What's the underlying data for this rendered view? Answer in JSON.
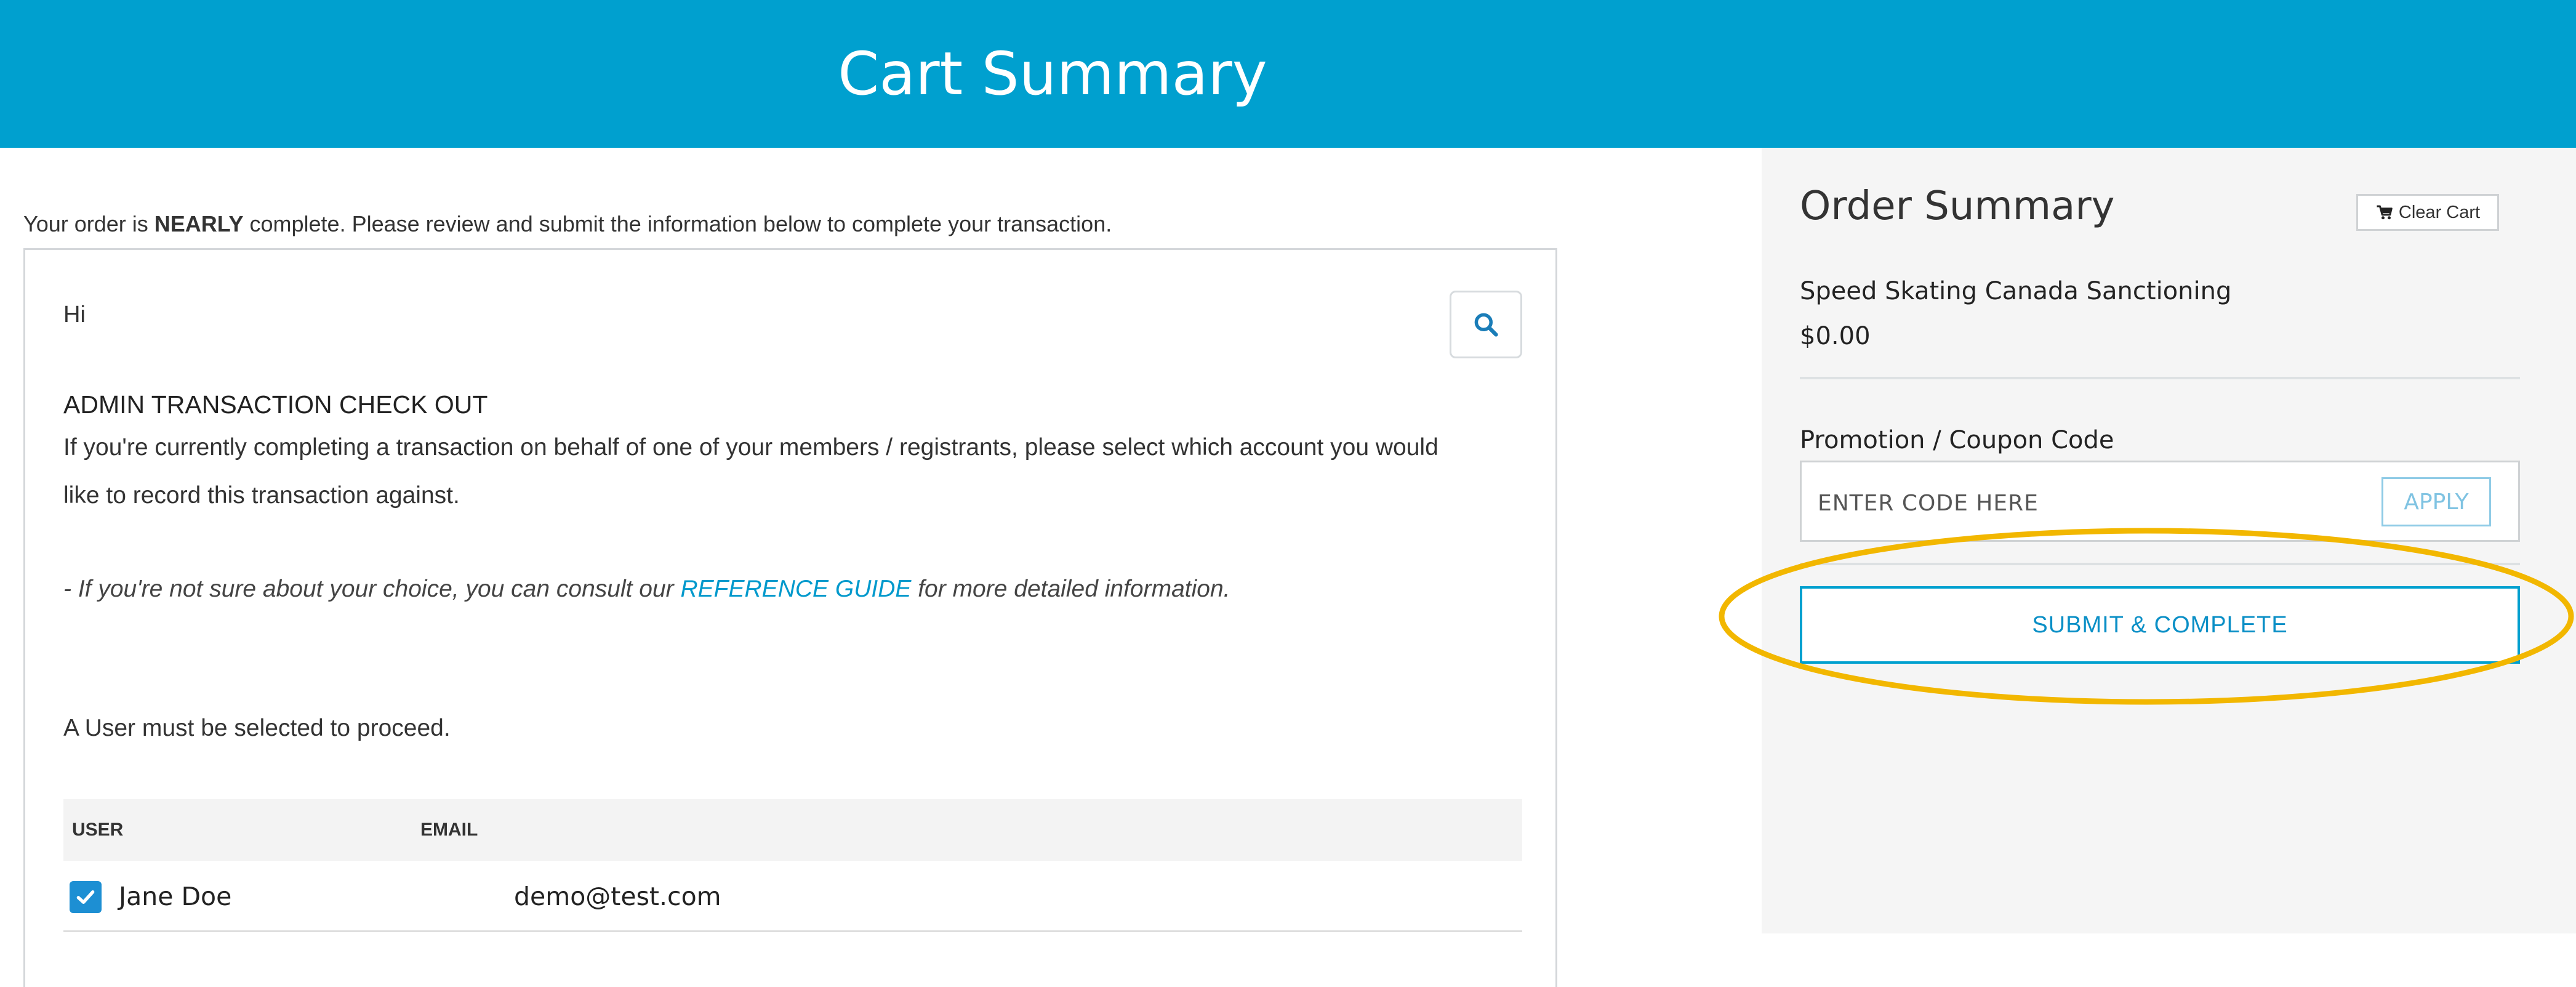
{
  "header": {
    "title": "Cart Summary"
  },
  "notice": {
    "prefix": "Your order is ",
    "emphasis": "NEARLY",
    "suffix": " complete. Please review and submit the information below to complete your transaction."
  },
  "card": {
    "greeting": "Hi",
    "heading": "ADMIN TRANSACTION CHECK OUT",
    "paragraph1": "If you're currently completing a transaction on behalf of one of your members / registrants, please select which account you would like to record this transaction against.",
    "paragraph2_prefix": "- If you're not sure about your choice, you can consult our ",
    "paragraph2_link": "REFERENCE GUIDE",
    "paragraph2_suffix": " for more detailed information.",
    "paragraph3": "A User must be selected to proceed.",
    "table": {
      "columns": [
        "USER",
        "EMAIL"
      ],
      "rows": [
        {
          "user": "Jane Doe",
          "email": "demo@test.com",
          "checked": true
        }
      ]
    }
  },
  "sidebar": {
    "title": "Order Summary",
    "clear_cart_label": "Clear Cart",
    "item_name": "Speed Skating Canada Sanctioning",
    "item_price": "$0.00",
    "promo_label": "Promotion / Coupon Code",
    "promo_placeholder": "ENTER CODE HERE",
    "apply_label": "APPLY",
    "submit_label": "SUBMIT & COMPLETE"
  },
  "colors": {
    "header_bg": "#00a0cf",
    "accent": "#0a8fc6",
    "checkbox": "#1d8fd3",
    "highlight": "#f2b700",
    "sidebar_bg": "#f5f5f5"
  },
  "icons": {
    "search": "search-icon",
    "cart": "cart-icon",
    "check": "checkmark-icon"
  }
}
